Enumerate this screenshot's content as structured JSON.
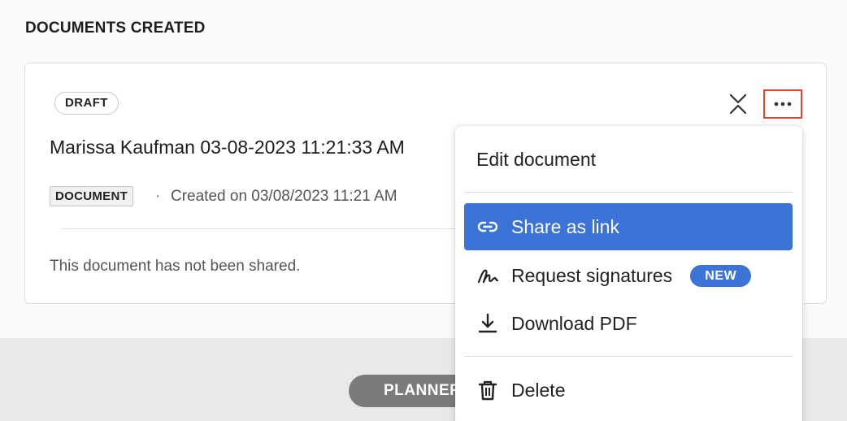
{
  "section": {
    "title": "DOCUMENTS CREATED"
  },
  "card": {
    "status_badge": "DRAFT",
    "title": "Marissa Kaufman 03-08-2023 11:21:33 AM",
    "doc_type": "DOCUMENT",
    "separator": "·",
    "created": "Created on 03/08/2023 11:21 AM",
    "share_status": "This document has not been shared.",
    "collapse_icon": "collapse-icon",
    "more_icon": "more-horizontal-icon"
  },
  "menu": {
    "edit": {
      "label": "Edit document"
    },
    "share": {
      "label": "Share as link",
      "icon": "link-icon"
    },
    "signatures": {
      "label": "Request signatures",
      "icon": "signature-icon",
      "badge": "NEW"
    },
    "download": {
      "label": "Download PDF",
      "icon": "download-icon"
    },
    "delete": {
      "label": "Delete",
      "icon": "trash-icon"
    }
  },
  "footer": {
    "pill_label": "PLANNER"
  },
  "colors": {
    "accent": "#3b73d6",
    "highlight_border": "#e5452d",
    "pill": "#7b7b7b"
  }
}
